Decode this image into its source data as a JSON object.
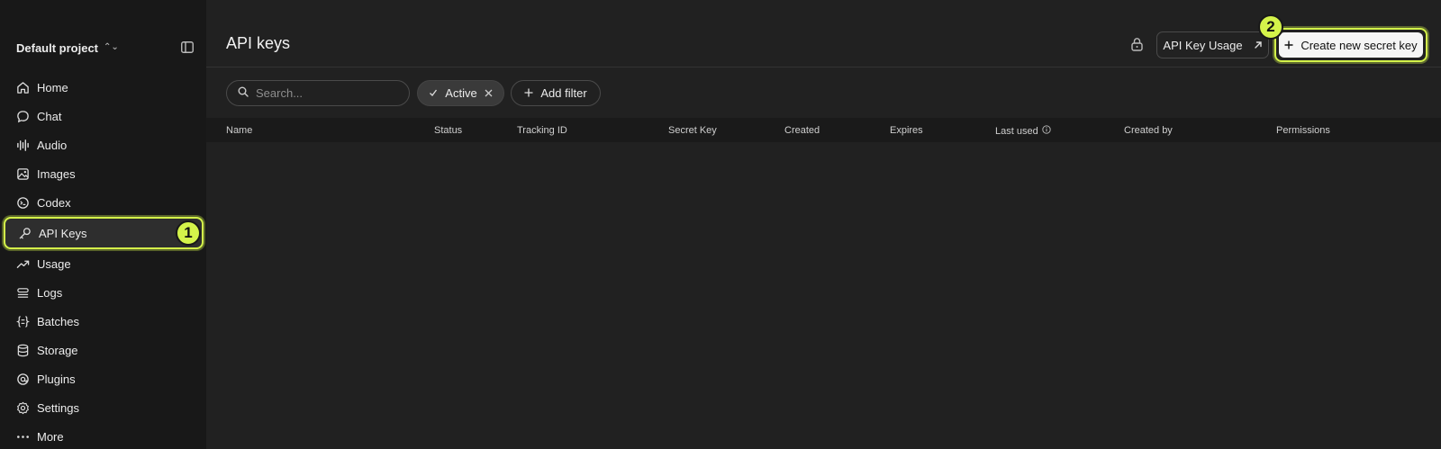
{
  "sidebar": {
    "project_name": "Default project",
    "items": [
      {
        "label": "Home",
        "icon": "home-icon"
      },
      {
        "label": "Chat",
        "icon": "chat-icon"
      },
      {
        "label": "Audio",
        "icon": "audio-icon"
      },
      {
        "label": "Images",
        "icon": "images-icon"
      },
      {
        "label": "Codex",
        "icon": "codex-icon"
      },
      {
        "label": "API Keys",
        "icon": "key-icon",
        "active": true,
        "badge": "1"
      },
      {
        "label": "Usage",
        "icon": "usage-icon"
      },
      {
        "label": "Logs",
        "icon": "logs-icon"
      },
      {
        "label": "Batches",
        "icon": "batches-icon"
      },
      {
        "label": "Storage",
        "icon": "storage-icon"
      },
      {
        "label": "Plugins",
        "icon": "plugins-icon"
      },
      {
        "label": "Settings",
        "icon": "gear-icon"
      },
      {
        "label": "More",
        "icon": "more-icon"
      }
    ]
  },
  "header": {
    "title": "API keys",
    "usage_button": "API Key Usage",
    "create_button": "Create new secret key",
    "create_badge": "2"
  },
  "filters": {
    "search_placeholder": "Search...",
    "active_chip": "Active",
    "add_filter": "Add filter"
  },
  "table": {
    "columns": [
      "Name",
      "Status",
      "Tracking ID",
      "Secret Key",
      "Created",
      "Expires",
      "Last used",
      "Created by",
      "Permissions"
    ]
  },
  "colors": {
    "accent": "#d4f34a",
    "background": "#212121",
    "sidebar": "#181818"
  }
}
